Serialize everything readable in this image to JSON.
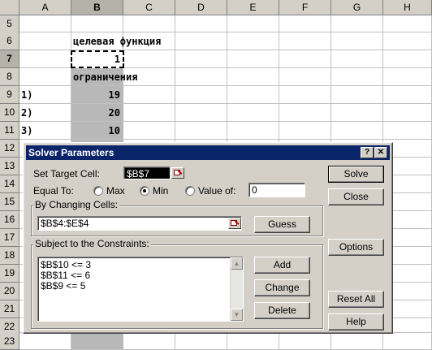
{
  "sheet": {
    "columns": [
      "A",
      "B",
      "C",
      "D",
      "E",
      "F",
      "G",
      "H"
    ],
    "selected_column": "B",
    "rows": [
      "5",
      "6",
      "7",
      "8",
      "9",
      "10",
      "11",
      "12",
      "13",
      "14",
      "15",
      "16",
      "17",
      "18",
      "19",
      "20",
      "21",
      "22",
      "23"
    ],
    "selected_row": "7",
    "cells": {
      "B6": "целевая функция",
      "B7": "1",
      "B8": "ограничения",
      "A9": "1)",
      "B9": "19",
      "A10": "2)",
      "B10": "20",
      "A11": "3)",
      "B11": "10"
    }
  },
  "dialog": {
    "title": "Solver Parameters",
    "help_glyph": "?",
    "close_glyph": "✕",
    "set_target_label": "Set Target Cell:",
    "target_value": "$B$7",
    "equal_to_label": "Equal To:",
    "options": {
      "max": "Max",
      "min": "Min",
      "value_of": "Value of:"
    },
    "selected_option": "min",
    "value_of_input": "0",
    "changing_cells_label": "By Changing Cells:",
    "changing_cells_value": "$B$4:$E$4",
    "constraints_label": "Subject to the Constraints:",
    "constraints": [
      "$B$10 <= 3",
      "$B$11 <= 6",
      "$B$9 <= 5"
    ],
    "buttons": {
      "solve": "Solve",
      "close": "Close",
      "guess": "Guess",
      "options": "Options",
      "add": "Add",
      "change": "Change",
      "delete": "Delete",
      "reset_all": "Reset All",
      "help": "Help"
    },
    "scroll_up_glyph": "▲",
    "scroll_down_glyph": "▼"
  }
}
